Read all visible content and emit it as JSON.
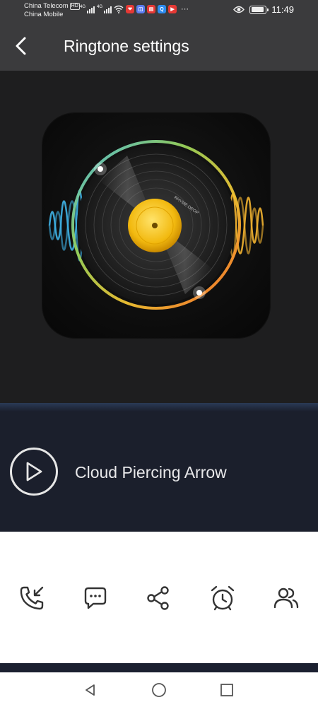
{
  "status_bar": {
    "carrier_1": "China Telecom",
    "carrier_1_badge": "HD",
    "carrier_2": "China Mobile",
    "network_1": "4G",
    "network_2": "4G",
    "more": "···",
    "time": "11:49",
    "app_icons": [
      "shopping-app-icon",
      "calendar-app-icon",
      "notes-app-icon",
      "browser-app-icon",
      "video-app-icon"
    ]
  },
  "header": {
    "title": "Ringtone settings"
  },
  "player": {
    "song_title": "Cloud Piercing Arrow",
    "album_art_text": "RHYME DROP"
  },
  "actions": [
    {
      "name": "set-call-ringtone-button",
      "icon": "phone-incoming-icon"
    },
    {
      "name": "set-message-tone-button",
      "icon": "message-bubble-icon"
    },
    {
      "name": "share-button",
      "icon": "share-icon"
    },
    {
      "name": "set-alarm-button",
      "icon": "alarm-clock-icon"
    },
    {
      "name": "set-contact-ringtone-button",
      "icon": "contacts-icon"
    }
  ],
  "colors": {
    "header_bg": "#3b3b3d",
    "player_band_bg": "#1b1f2c",
    "record_label": "#f5c518"
  }
}
